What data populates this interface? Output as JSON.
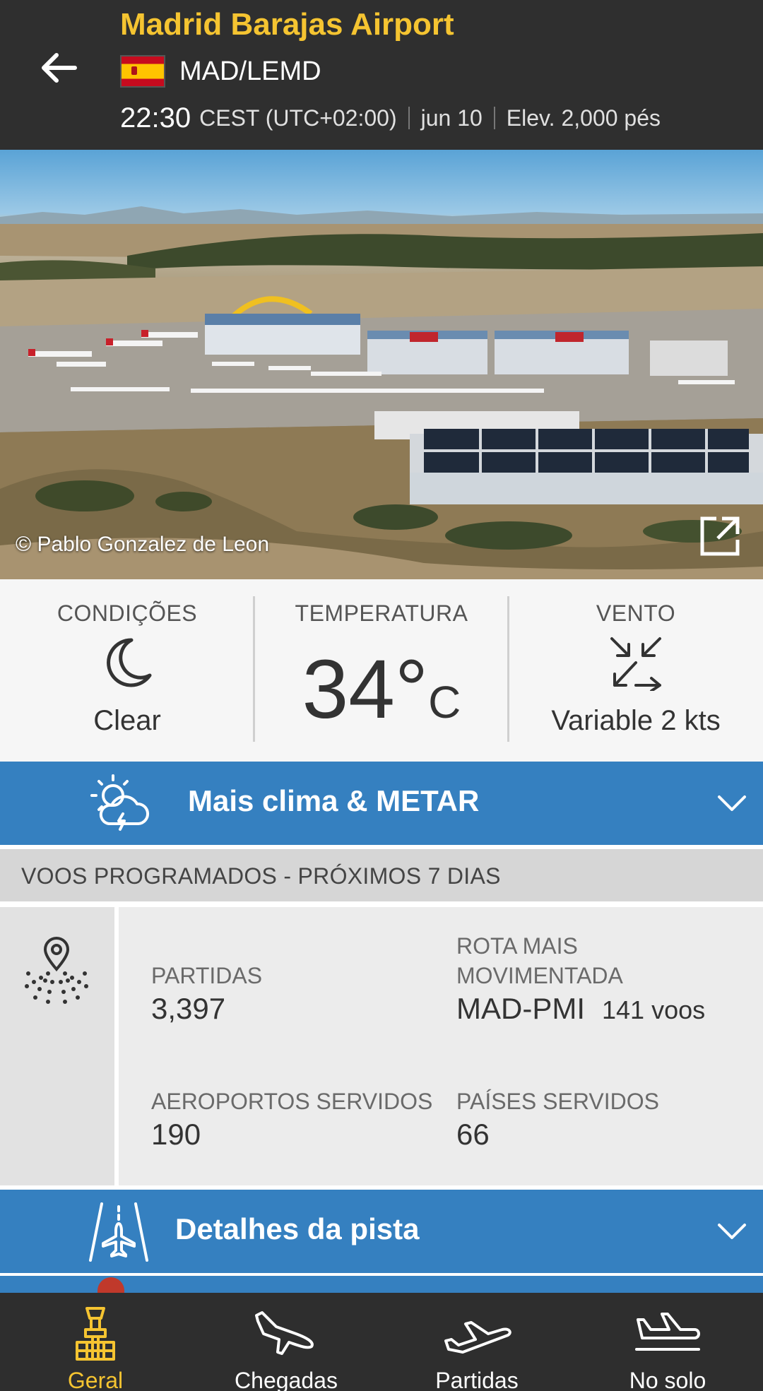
{
  "header": {
    "airport_name": "Madrid Barajas Airport",
    "code": "MAD/LEMD",
    "time": "22:30",
    "timezone": "CEST (UTC+02:00)",
    "date": "jun 10",
    "elevation": "Elev. 2,000 pés"
  },
  "photo": {
    "credit": "© Pablo Gonzalez de Leon"
  },
  "conditions": {
    "label": "CONDIÇÕES",
    "value": "Clear",
    "icon": "moon-icon"
  },
  "temperature": {
    "label": "TEMPERATURA",
    "value": "34°",
    "unit": "C"
  },
  "wind": {
    "label": "VENTO",
    "value": "Variable 2 kts",
    "icon": "variable-wind-icon"
  },
  "weather_bar": {
    "label": "Mais clima & METAR"
  },
  "scheduled": {
    "header": "VOOS PROGRAMADOS - PRÓXIMOS 7 DIAS",
    "departures_label": "PARTIDAS",
    "departures_value": "3,397",
    "busiest_route_label_1": "ROTA MAIS",
    "busiest_route_label_2": "MOVIMENTADA",
    "busiest_route_value": "MAD-PMI",
    "busiest_route_flights": "141 voos",
    "airports_label": "AEROPORTOS SERVIDOS",
    "airports_value": "190",
    "countries_label": "PAÍSES SERVIDOS",
    "countries_value": "66"
  },
  "runway_bar": {
    "label": "Detalhes da pista"
  },
  "bottom_nav": [
    {
      "label": "Geral",
      "icon": "airport-tower-icon",
      "active": true
    },
    {
      "label": "Chegadas",
      "icon": "arrival-plane-icon",
      "active": false
    },
    {
      "label": "Partidas",
      "icon": "departure-plane-icon",
      "active": false
    },
    {
      "label": "No solo",
      "icon": "on-ground-plane-icon",
      "active": false
    }
  ],
  "colors": {
    "header_bg": "#2f2f2f",
    "accent_yellow": "#f5c431",
    "bar_blue": "#3580c0"
  }
}
